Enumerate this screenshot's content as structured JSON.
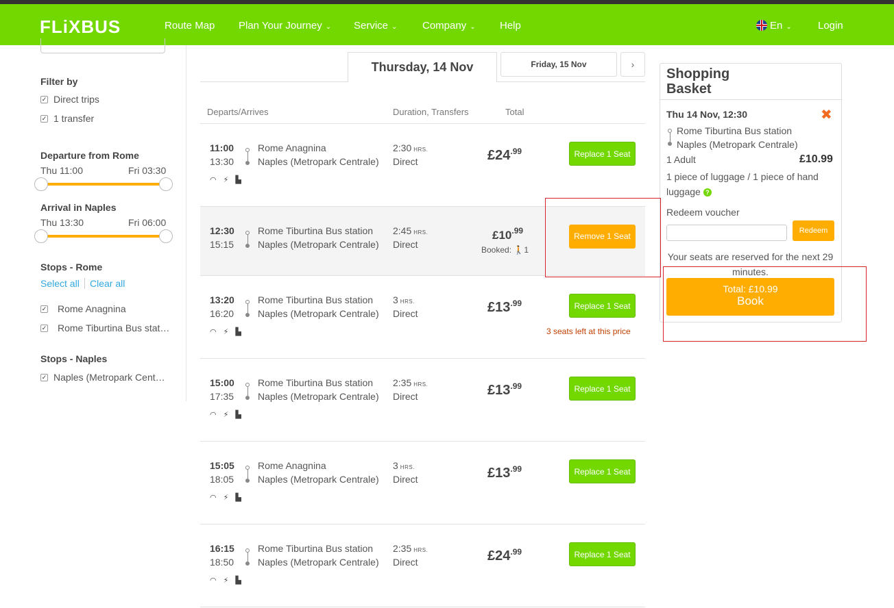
{
  "header": {
    "logo": "FLiXBUS",
    "nav": [
      {
        "label": "Route Map"
      },
      {
        "label": "Plan Your Journey"
      },
      {
        "label": "Service"
      },
      {
        "label": "Company"
      },
      {
        "label": "Help"
      }
    ],
    "language": "En",
    "login": "Login"
  },
  "sidebar": {
    "filter_title": "Filter by",
    "filters": [
      "Direct trips",
      "1 transfer"
    ],
    "departure_title": "Departure from Rome",
    "departure_min": "Thu 11:00",
    "departure_max": "Fri 03:30",
    "arrival_title": "Arrival in Naples",
    "arrival_min": "Thu 13:30",
    "arrival_max": "Fri 06:00",
    "stops_rome_title": "Stops - Rome",
    "select_all": "Select all",
    "clear_all": "Clear all",
    "stops_rome": [
      "Rome Anagnina",
      "Rome Tiburtina Bus stat…"
    ],
    "stops_naples_title": "Stops - Naples",
    "stops_naples": [
      "Naples (Metropark Cent…"
    ]
  },
  "dates": {
    "active": "Thursday, 14 Nov",
    "next": "Friday, 15 Nov",
    "next_arrow": "›"
  },
  "columns": {
    "departs": "Departs/Arrives",
    "duration": "Duration, Transfers",
    "total": "Total"
  },
  "hrs_unit": "HRS.",
  "rides": [
    {
      "dep": "11:00",
      "arr": "13:30",
      "from": "Rome Anagnina",
      "to": "Naples (Metropark Centrale)",
      "dur": "2:30",
      "transfers": "Direct",
      "price": "£24",
      "cents": ".99",
      "button": "Replace 1 Seat"
    },
    {
      "dep": "12:30",
      "arr": "15:15",
      "from": "Rome Tiburtina Bus station",
      "to": "Naples (Metropark Centrale)",
      "dur": "2:45",
      "transfers": "Direct",
      "price": "£10",
      "cents": ".99",
      "button": "Remove 1 Seat",
      "booked_label": "Booked:",
      "booked_count": "1"
    },
    {
      "dep": "13:20",
      "arr": "16:20",
      "from": "Rome Tiburtina Bus station",
      "to": "Naples (Metropark Centrale)",
      "dur": "3",
      "transfers": "Direct",
      "price": "£13",
      "cents": ".99",
      "button": "Replace 1 Seat",
      "note": "3 seats left at this price"
    },
    {
      "dep": "15:00",
      "arr": "17:35",
      "from": "Rome Tiburtina Bus station",
      "to": "Naples (Metropark Centrale)",
      "dur": "2:35",
      "transfers": "Direct",
      "price": "£13",
      "cents": ".99",
      "button": "Replace 1 Seat"
    },
    {
      "dep": "15:05",
      "arr": "18:05",
      "from": "Rome Anagnina",
      "to": "Naples (Metropark Centrale)",
      "dur": "3",
      "transfers": "Direct",
      "price": "£13",
      "cents": ".99",
      "button": "Replace 1 Seat"
    },
    {
      "dep": "16:15",
      "arr": "18:50",
      "from": "Rome Tiburtina Bus station",
      "to": "Naples (Metropark Centrale)",
      "dur": "2:35",
      "transfers": "Direct",
      "price": "£24",
      "cents": ".99",
      "button": "Replace 1 Seat"
    }
  ],
  "basket": {
    "title": "Shopping Basket",
    "trip": "Thu 14 Nov, 12:30",
    "from": "Rome Tiburtina Bus station",
    "to": "Naples (Metropark Centrale)",
    "passenger": "1 Adult",
    "price": "£10.99",
    "luggage": "1 piece of luggage / 1 piece of hand luggage",
    "voucher_label": "Redeem voucher",
    "redeem": "Redeem",
    "reserved_note": "Your seats are reserved for the next 29 minutes.",
    "total": "Total: £10.99",
    "book": "Book"
  },
  "colors": {
    "brand_green": "#73d700",
    "accent_orange": "#ffad00",
    "remove_red": "#f26b21",
    "highlight": "#d9232c"
  }
}
